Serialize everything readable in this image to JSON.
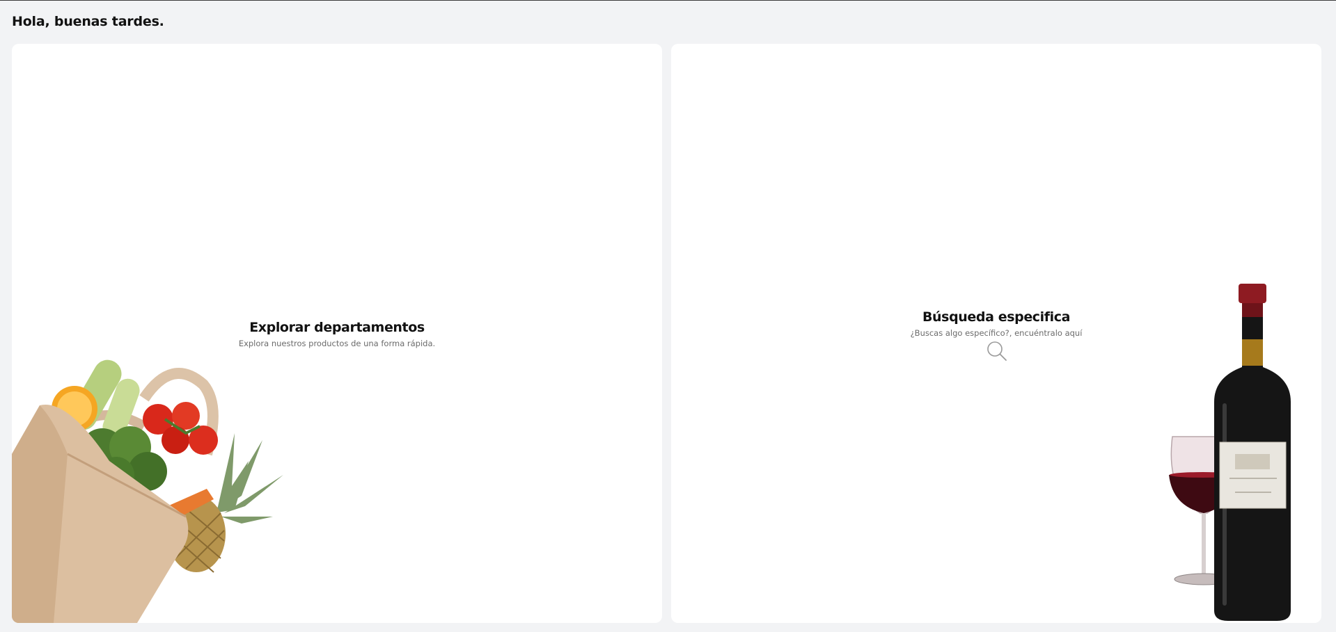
{
  "greeting": "Hola, buenas tardes.",
  "cards": [
    {
      "title": "Explorar departamentos",
      "subtitle": "Explora nuestros productos de una forma rápida.",
      "image": "grocery-bag-illustration"
    },
    {
      "title": "Búsqueda especifica",
      "subtitle": "¿Buscas algo específico?, encuéntralo aquí",
      "icon": "search-icon",
      "image": "wine-bottle-glass-illustration"
    }
  ],
  "colors": {
    "background": "#f2f3f5",
    "card": "#ffffff",
    "text": "#111111",
    "muted": "#6b6b6b"
  }
}
